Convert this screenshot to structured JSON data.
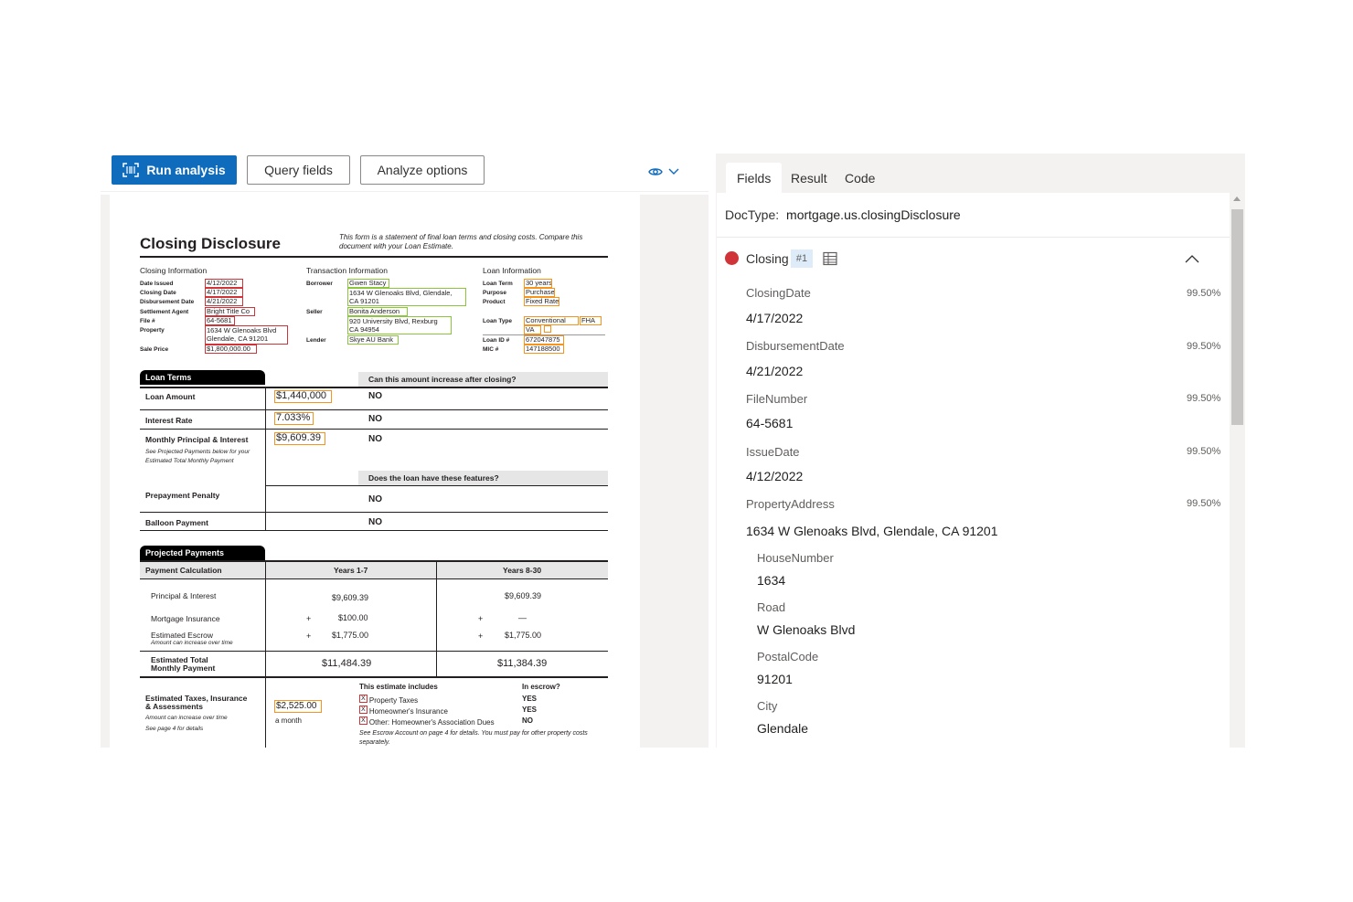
{
  "toolbar": {
    "run_analysis": "Run analysis",
    "query_fields": "Query fields",
    "analyze_options": "Analyze options"
  },
  "colors": {
    "accent": "#0f6cbd",
    "closing_dot": "#d13438",
    "field_red": "#d13438",
    "field_green": "#8cc63f",
    "field_orange": "#f7941d"
  },
  "document": {
    "title": "Closing Disclosure",
    "note": "This form is a statement of final loan terms and closing costs. Compare this document with your Loan Estimate.",
    "closing_info": {
      "header": "Closing  Information",
      "labels": [
        "Date Issued",
        "Closing Date",
        "Disbursement Date",
        "Settlement Agent",
        "File #",
        "Property",
        "Sale Price"
      ],
      "date_issued": "4/12/2022",
      "closing_date": "4/17/2022",
      "disbursement_date": "4/21/2022",
      "settlement_agent": "Bright Title Co",
      "file_no": "64-5681",
      "property_line1": "1634 W Glenoaks Blvd",
      "property_line2": "Glendale, CA 91201",
      "sale_price": "$1,800,000.00"
    },
    "transaction_info": {
      "header": "Transaction  Information",
      "labels": [
        "Borrower",
        "Seller",
        "Lender"
      ],
      "borrower": "Gwen Stacy",
      "borrower_addr1": "1634 W Glenoaks Blvd, Glendale,",
      "borrower_addr2": "CA 91201",
      "seller": "Bonita Anderson",
      "seller_addr1": "920 University Blvd, Rexburg",
      "seller_addr2": "CA 94954",
      "lender": "Skye AU Bank"
    },
    "loan_info": {
      "header": "Loan  Information",
      "labels": [
        "Loan Term",
        "Purpose",
        "Product",
        "Loan Type",
        "Loan ID #",
        "MIC #"
      ],
      "loan_term": "30 years",
      "purpose": "Purchase",
      "product": "Fixed Rate",
      "loan_type_conventional": "Conventional",
      "loan_type_fha": "FHA",
      "loan_type_va": "VA",
      "loan_id": "672047875",
      "mic": "147188500"
    },
    "loan_terms": {
      "header": "Loan Terms",
      "question1": "Can this amount increase after closing?",
      "question2": "Does the loan have these features?",
      "rows": [
        {
          "label": "Loan Amount",
          "value": "$1,440,000",
          "answer": "NO"
        },
        {
          "label": "Interest Rate",
          "value": "7.033%",
          "answer": "NO"
        },
        {
          "label": "Monthly Principal & Interest",
          "sub": "See Projected Payments below for your Estimated Total Monthly Payment",
          "value": "$9,609.39",
          "answer": "NO"
        },
        {
          "label": "Prepayment Penalty",
          "answer": "NO"
        },
        {
          "label": "Balloon Payment",
          "answer": "NO"
        }
      ]
    },
    "projected": {
      "header": "Projected Payments",
      "col0": "Payment Calculation",
      "col1": "Years 1-7",
      "col2": "Years 8-30",
      "pi_label": "Principal & Interest",
      "pi_1": "$9,609.39",
      "pi_2": "$9,609.39",
      "mi_label": "Mortgage Insurance",
      "mi_1": "$100.00",
      "mi_2": "—",
      "esc_label": "Estimated Escrow",
      "esc_sub": "Amount can increase over time",
      "esc_1": "$1,775.00",
      "esc_2": "$1,775.00",
      "plus": "+",
      "total_label1": "Estimated Total",
      "total_label2": "Monthly Payment",
      "total_1": "$11,484.39",
      "total_2": "$11,384.39",
      "taxes_label1": "Estimated Taxes, Insurance",
      "taxes_label2": "& Assessments",
      "taxes_sub1": "Amount can increase over time",
      "taxes_sub2": "See page 4 for details",
      "taxes_value": "$2,525.00",
      "taxes_period": "a month",
      "includes_header": "This estimate includes",
      "escrow_header": "In escrow?",
      "includes": [
        {
          "label": "Property Taxes",
          "escrow": "YES"
        },
        {
          "label": "Homeowner's Insurance",
          "escrow": "YES"
        },
        {
          "label": "Other: Homeowner's Association Dues",
          "escrow": "NO"
        }
      ],
      "x_mark": "X",
      "footnote": "See Escrow Account on page 4 for details. You must pay for other property costs separately."
    }
  },
  "panel": {
    "tabs": [
      "Fields",
      "Result",
      "Code"
    ],
    "doctype_label": "DocType:",
    "doctype_value": "mortgage.us.closingDisclosure",
    "group_name": "Closing",
    "group_badge": "#1",
    "fields": [
      {
        "name": "ClosingDate",
        "value": "4/17/2022",
        "confidence": "99.50%"
      },
      {
        "name": "DisbursementDate",
        "value": "4/21/2022",
        "confidence": "99.50%"
      },
      {
        "name": "FileNumber",
        "value": "64-5681",
        "confidence": "99.50%"
      },
      {
        "name": "IssueDate",
        "value": "4/12/2022",
        "confidence": "99.50%"
      },
      {
        "name": "PropertyAddress",
        "value": "1634 W Glenoaks Blvd, Glendale, CA 91201",
        "confidence": "99.50%"
      }
    ],
    "subfields": [
      {
        "name": "HouseNumber",
        "value": "1634"
      },
      {
        "name": "Road",
        "value": "W Glenoaks Blvd"
      },
      {
        "name": "PostalCode",
        "value": "91201"
      },
      {
        "name": "City",
        "value": "Glendale"
      }
    ]
  }
}
